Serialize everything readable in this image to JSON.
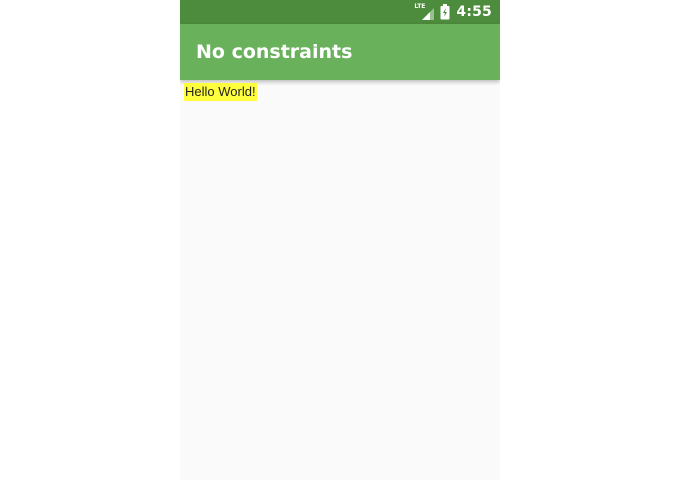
{
  "status_bar": {
    "network_label": "LTE",
    "time": "4:55",
    "icons": [
      "lte-signal-icon",
      "battery-charging-icon"
    ]
  },
  "app_bar": {
    "title": "No constraints"
  },
  "content": {
    "hello_text": "Hello World!"
  },
  "colors": {
    "status_bar": "#4d8b3d",
    "app_bar": "#6ab15c",
    "background": "#fafafa",
    "highlight": "#ffff3b"
  }
}
